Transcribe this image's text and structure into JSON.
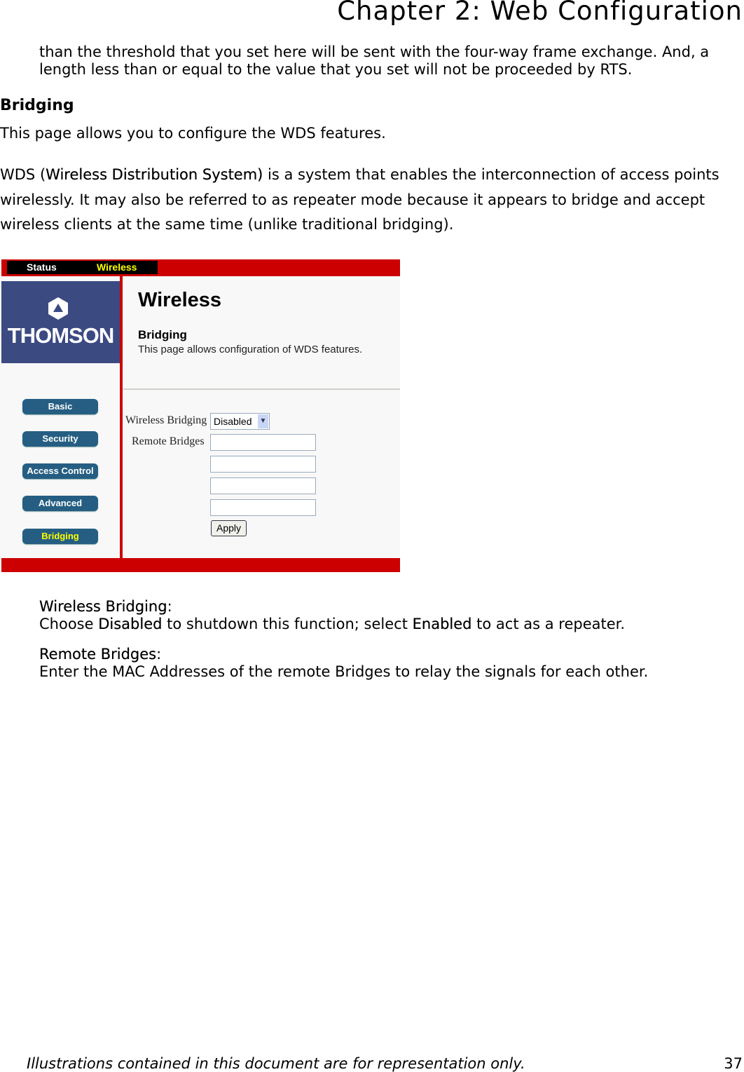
{
  "header": {
    "chapter": "Chapter 2: Web Configuration"
  },
  "intro": {
    "line1": "than the threshold that you set here will be sent with the four-way frame exchange. And, a",
    "line2": "length less than or equal to the value that you set will not be proceeded by RTS."
  },
  "section": {
    "title": "Bridging",
    "desc": "This page allows you to configure the WDS features.",
    "wds_prefix": "WDS (",
    "wds_term": "Wireless Distribution System)",
    "wds_line1_rest": " is a system that enables the interconnection of access points",
    "wds_line2": "wirelessly. It may also be referred to as repeater mode because it appears to bridge and accept",
    "wds_line3": "wireless clients at the same time (unlike traditional bridging)."
  },
  "screenshot": {
    "tabs": [
      "Status",
      "Wireless"
    ],
    "logo_text": "THOMSON",
    "page_title": "Wireless",
    "sub_title": "Bridging",
    "sub_desc": "This page allows configuration of WDS features.",
    "nav": [
      "Basic",
      "Security",
      "Access Control",
      "Advanced",
      "Bridging"
    ],
    "form": {
      "wireless_bridging_label": "Wireless Bridging",
      "wireless_bridging_value": "Disabled",
      "remote_bridges_label": "Remote Bridges",
      "remote_bridges": [
        "",
        "",
        "",
        ""
      ],
      "apply": "Apply"
    },
    "colors": {
      "red": "#cc0000",
      "blue": "#3c4a82",
      "nav": "#255e82",
      "active": "#ffff00"
    }
  },
  "fields": [
    {
      "term": "Wireless Bridging",
      "colon": ":",
      "pre": "Choose ",
      "b1": "Disabled",
      "mid": " to shutdown this function; select ",
      "b2": "Enabled",
      "post": " to act as a repeater."
    },
    {
      "term": "Remote Bridges",
      "colon": ":",
      "text": "Enter the MAC Addresses of the remote Bridges to relay the signals for each other."
    }
  ],
  "footer": {
    "note": "Illustrations contained in this document are for representation only.",
    "page": "37"
  }
}
